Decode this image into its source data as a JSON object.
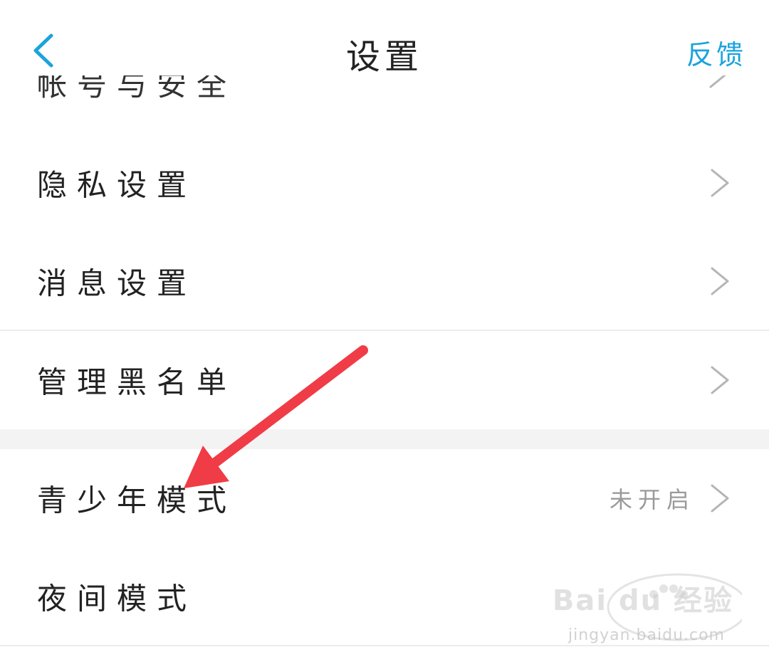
{
  "header": {
    "title": "设置",
    "feedback_label": "反馈",
    "accent_color": "#1aa3dc"
  },
  "partial_item": {
    "label": "帐号与安全"
  },
  "items": [
    {
      "label": "隐私设置"
    },
    {
      "label": "消息设置"
    },
    {
      "label": "管理黑名单"
    },
    {
      "label": "青少年模式",
      "status": "未开启"
    },
    {
      "label": "夜间模式"
    }
  ],
  "annotation": {
    "arrow_color": "#f03c46"
  },
  "watermark": {
    "brand": "Bai du 经验",
    "url": "jingyan.baidu.com"
  }
}
